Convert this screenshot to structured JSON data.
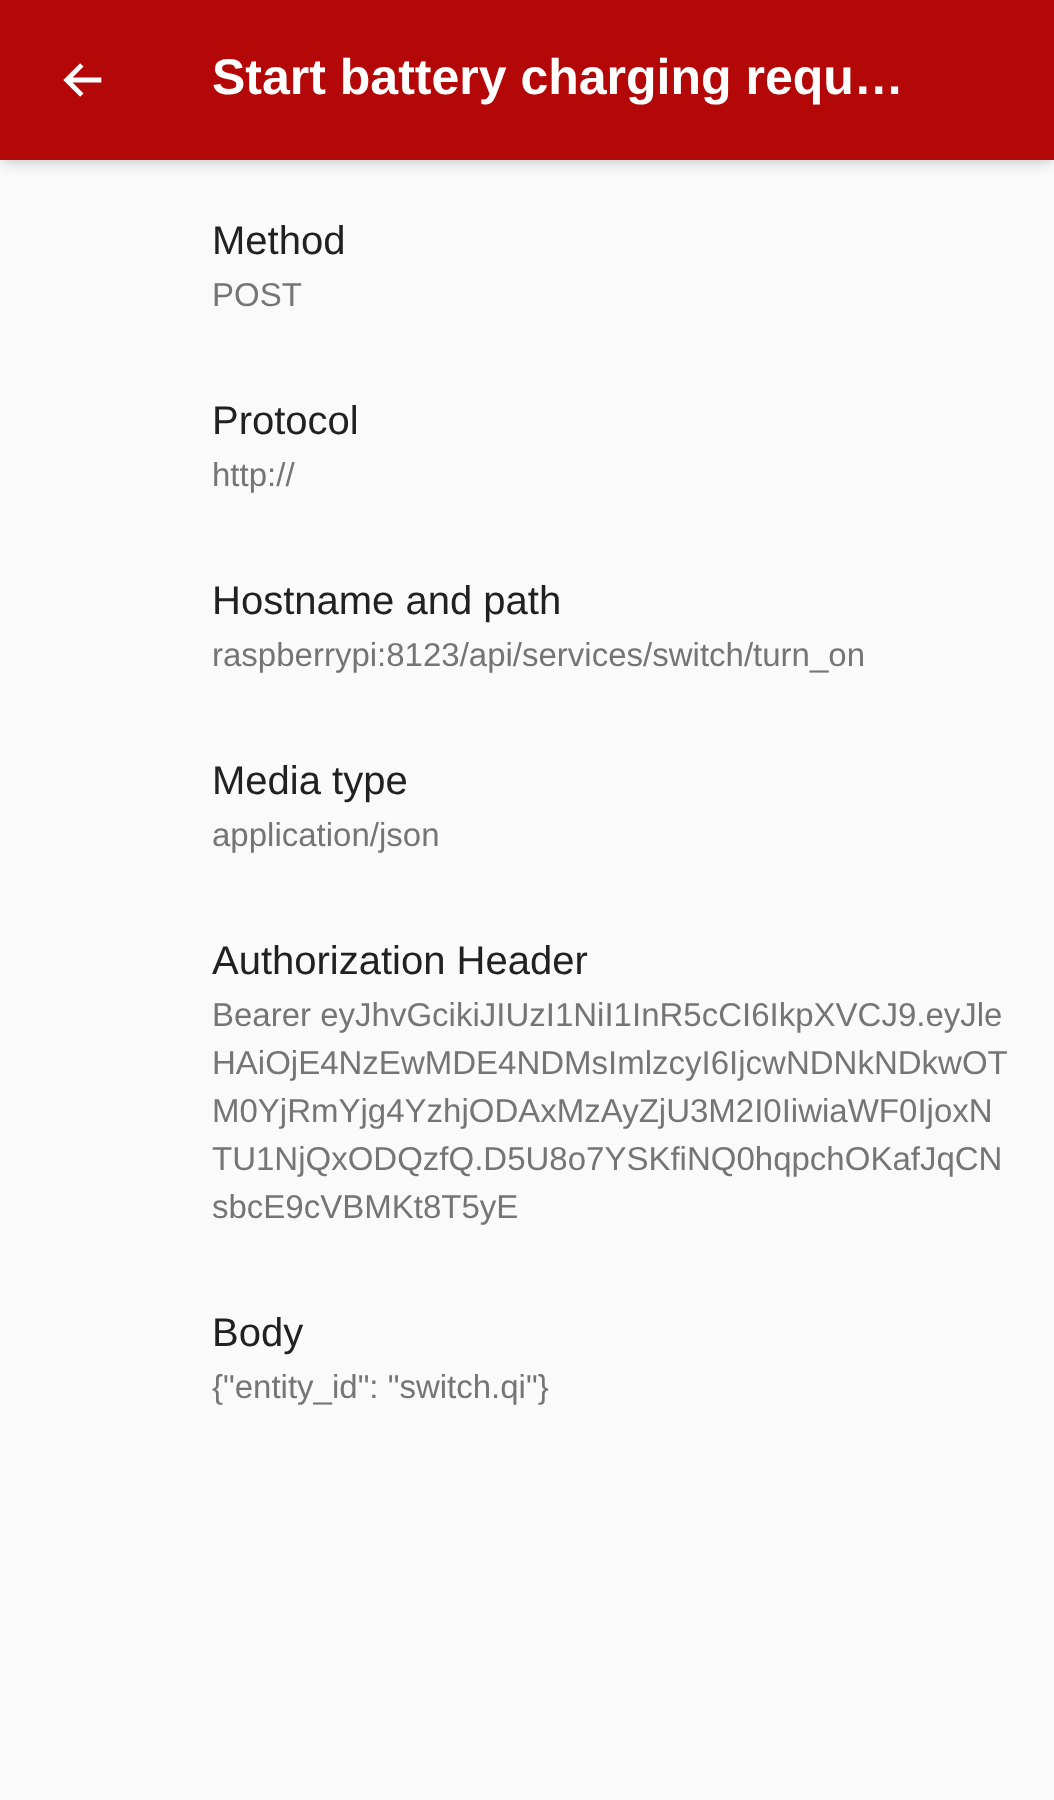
{
  "app_bar": {
    "title": "Start battery charging requ…"
  },
  "fields": [
    {
      "label": "Method",
      "value": "POST"
    },
    {
      "label": "Protocol",
      "value": "http://"
    },
    {
      "label": "Hostname and path",
      "value": "raspberrypi:8123/api/services/switch/turn_on"
    },
    {
      "label": "Media type",
      "value": "application/json"
    },
    {
      "label": "Authorization Header",
      "value": "Bearer eyJhvGcikiJIUzI1NiI1InR5cCI6IkpXVCJ9.eyJleHAiOjE4NzEwMDE4NDMsImlzcyI6IjcwNDNkNDkwOTM0YjRmYjg4YzhjODAxMzAyZjU3M2I0IiwiaWF0IjoxNTU1NjQxODQzfQ.D5U8o7YSKfiNQ0hqpchOKafJqCNsbcE9cVBMKt8T5yE"
    },
    {
      "label": "Body",
      "value": "{\"entity_id\": \"switch.qi\"}"
    }
  ]
}
